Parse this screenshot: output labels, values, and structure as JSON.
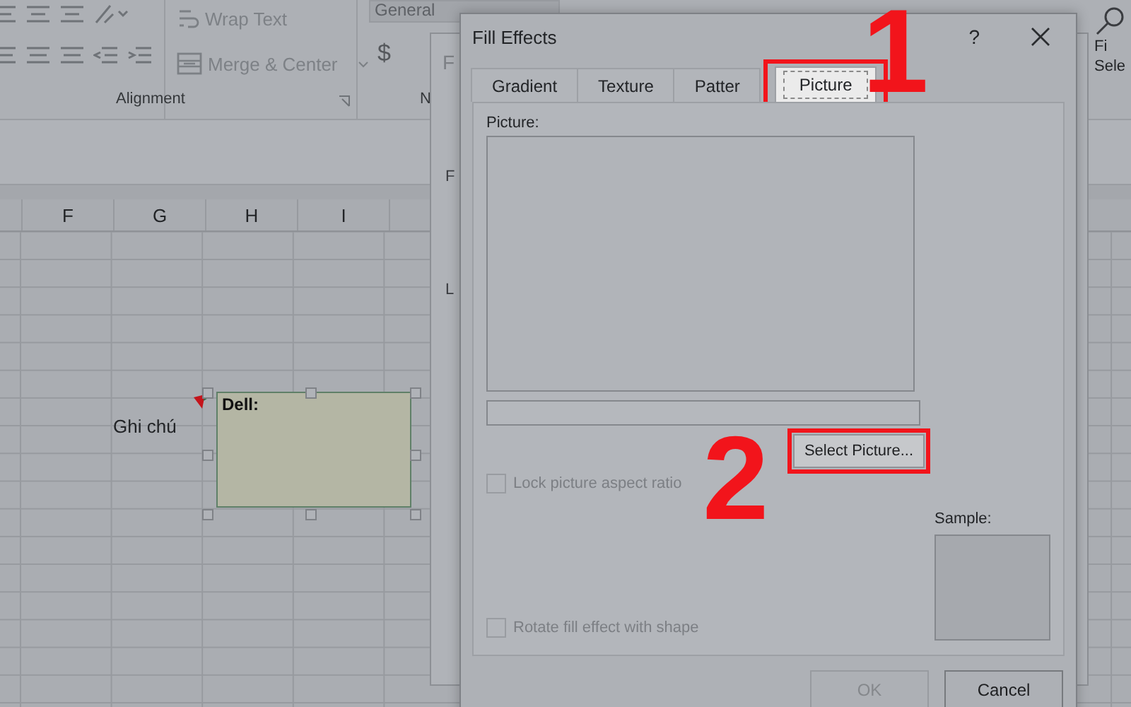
{
  "ribbon": {
    "number_format": "General",
    "wrap_text": "Wrap Text",
    "merge_center": "Merge & Center",
    "currency": "$",
    "group_labels": [
      "Alignment",
      "N"
    ],
    "find_select": [
      "Fi",
      "Sele"
    ]
  },
  "sheet": {
    "columns": [
      "F",
      "G",
      "H",
      "I"
    ],
    "cell_text": "Ghi chú",
    "comment": {
      "text": "Dell:"
    }
  },
  "background_dialog": {
    "title": "F",
    "labels": [
      "F",
      "L"
    ]
  },
  "dialog": {
    "title": "Fill Effects",
    "help": "?",
    "tabs": [
      {
        "label": "Gradient",
        "selected": false,
        "highlighted": false
      },
      {
        "label": "Texture",
        "selected": false,
        "highlighted": false
      },
      {
        "label": "Patter",
        "selected": false,
        "highlighted": false
      },
      {
        "label": "Picture",
        "selected": true,
        "highlighted": true
      }
    ],
    "picture_label": "Picture:",
    "select_button": {
      "label": "Select Picture...",
      "highlighted": true
    },
    "checkboxes": [
      {
        "label": "Lock picture aspect ratio",
        "checked": false,
        "disabled": true
      },
      {
        "label": "Rotate fill effect with shape",
        "checked": false,
        "disabled": true
      }
    ],
    "sample_label": "Sample:",
    "buttons": [
      {
        "label": "OK",
        "disabled": true
      },
      {
        "label": "Cancel",
        "disabled": false
      }
    ]
  },
  "annotations": [
    {
      "label": "1"
    },
    {
      "label": "2"
    }
  ]
}
